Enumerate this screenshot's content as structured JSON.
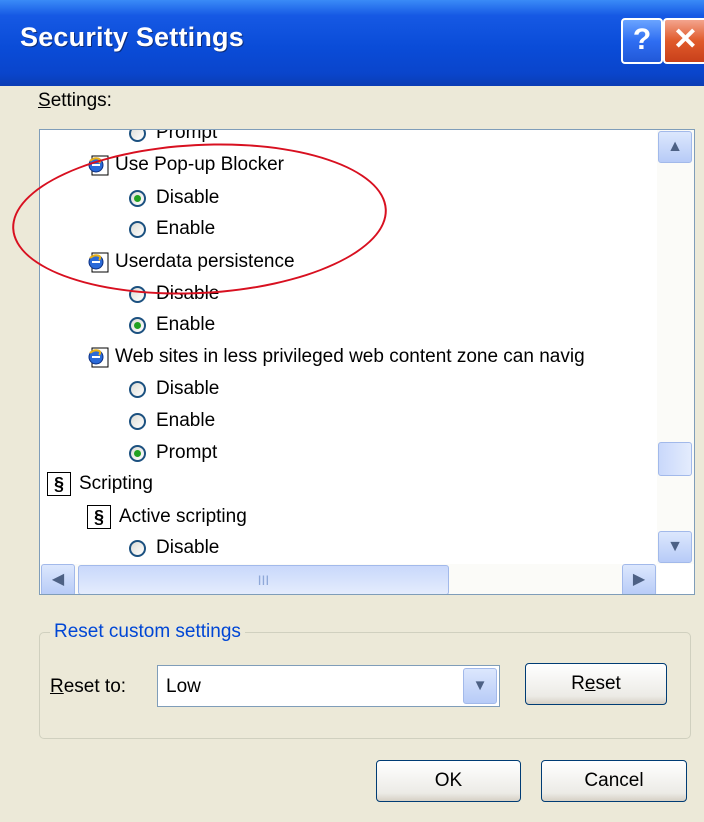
{
  "window": {
    "title": "Security Settings",
    "help_label": "?",
    "close_label": "✕"
  },
  "settings_label": "Settings:",
  "tree": [
    {
      "kind": "radio",
      "label": "Prompt",
      "checked": false,
      "cut": "top"
    },
    {
      "kind": "ie",
      "label": "Use Pop-up Blocker"
    },
    {
      "kind": "radio",
      "label": "Disable",
      "checked": true
    },
    {
      "kind": "radio",
      "label": "Enable",
      "checked": false
    },
    {
      "kind": "ie",
      "label": "Userdata persistence"
    },
    {
      "kind": "radio",
      "label": "Disable",
      "checked": false
    },
    {
      "kind": "radio",
      "label": "Enable",
      "checked": true
    },
    {
      "kind": "ie",
      "label": "Web sites in less privileged web content zone can navig"
    },
    {
      "kind": "radio",
      "label": "Disable",
      "checked": false
    },
    {
      "kind": "radio",
      "label": "Enable",
      "checked": false
    },
    {
      "kind": "radio",
      "label": "Prompt",
      "checked": true
    },
    {
      "kind": "script",
      "label": "Scripting"
    },
    {
      "kind": "script",
      "label": "Active scripting"
    },
    {
      "kind": "radio",
      "label": "Disable",
      "checked": false,
      "cut": "bottom"
    }
  ],
  "scroll": {
    "up": "▲",
    "down": "▼",
    "left": "◀",
    "right": "▶",
    "thumb_grip": "III"
  },
  "reset_group": {
    "title": "Reset custom settings",
    "reset_to_label": "Reset to:",
    "selected": "Low",
    "dropdown_arrow": "▼",
    "reset_button": "Reset"
  },
  "buttons": {
    "ok": "OK",
    "cancel": "Cancel"
  },
  "colors": {
    "titlebar": "#0a4cd8",
    "dialog_bg": "#ece9d8",
    "annotation": "#d81020",
    "group_title": "#0046d5"
  }
}
